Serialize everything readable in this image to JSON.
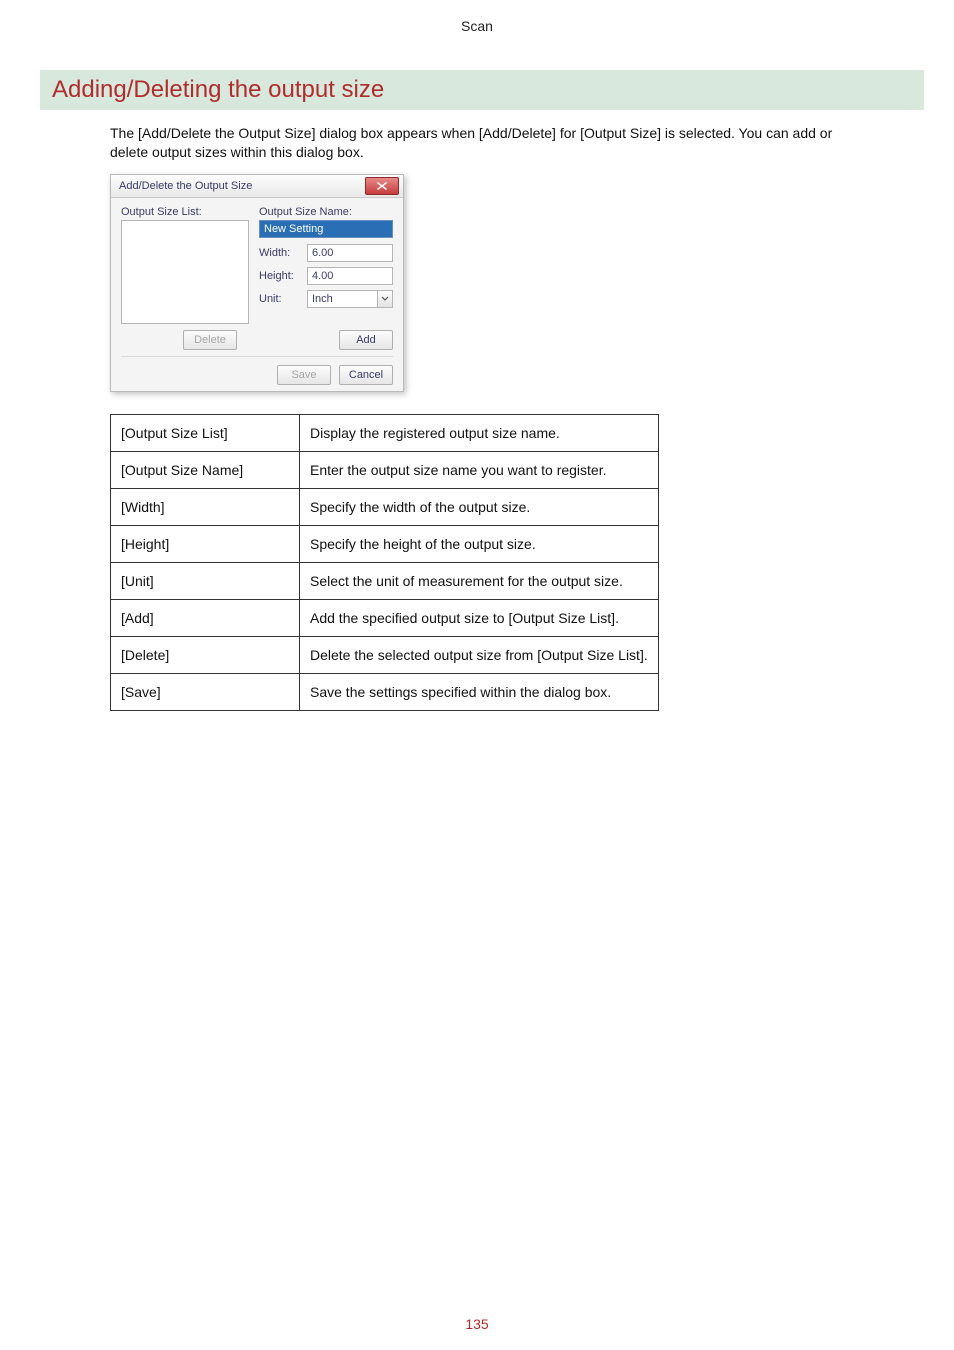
{
  "page": {
    "header": "Scan",
    "heading": "Adding/Deleting the output size",
    "intro": "The [Add/Delete the Output Size] dialog box appears when [Add/Delete] for [Output Size] is selected. You can add or delete output sizes within this dialog box.",
    "page_number": "135"
  },
  "dialog": {
    "title": "Add/Delete the Output Size",
    "list_label": "Output Size List:",
    "name_label": "Output Size Name:",
    "name_value": "New Setting",
    "width_label": "Width:",
    "width_value": "6.00",
    "height_label": "Height:",
    "height_value": "4.00",
    "unit_label": "Unit:",
    "unit_value": "Inch",
    "delete_btn": "Delete",
    "add_btn": "Add",
    "save_btn": "Save",
    "cancel_btn": "Cancel"
  },
  "defs": [
    {
      "k": "[Output Size List]",
      "v": "Display the registered output size name."
    },
    {
      "k": "[Output Size Name]",
      "v": "Enter the output size name you want to register."
    },
    {
      "k": "[Width]",
      "v": "Specify the width of the output size."
    },
    {
      "k": "[Height]",
      "v": "Specify the height of the output size."
    },
    {
      "k": "[Unit]",
      "v": "Select the unit of measurement for the output size."
    },
    {
      "k": "[Add]",
      "v": "Add the specified output size to [Output Size List]."
    },
    {
      "k": "[Delete]",
      "v": "Delete the selected output size from [Output Size List]."
    },
    {
      "k": "[Save]",
      "v": "Save the settings specified within the dialog box."
    }
  ]
}
